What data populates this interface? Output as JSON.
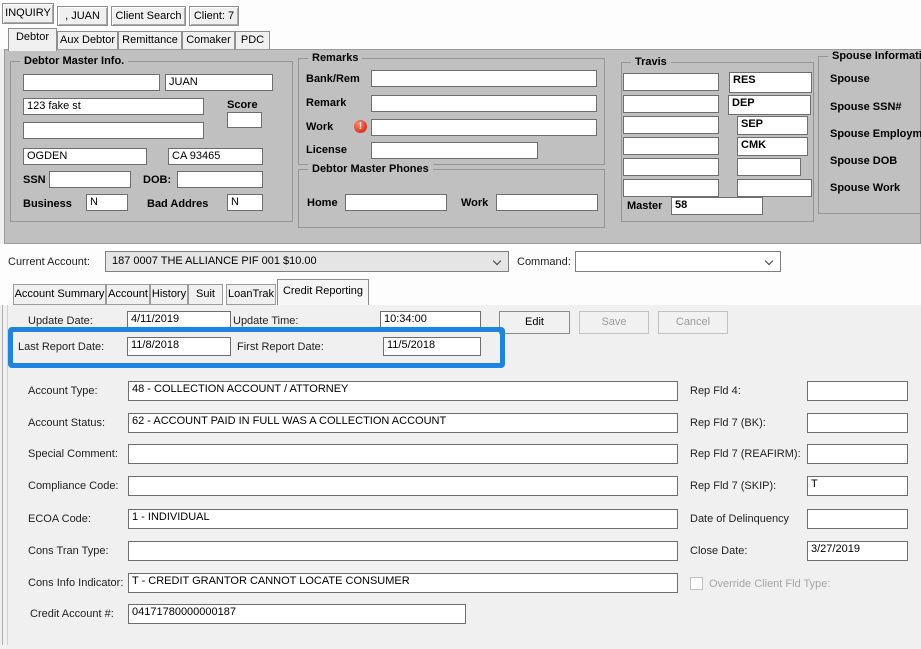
{
  "colors": {
    "highlight_blue": "#1e84e4",
    "alert_red": "#dd2c17",
    "panel_gray": "#c0c0c0"
  },
  "icons": {
    "work_alert": "!"
  },
  "top_buttons": {
    "inquiry": "INQUIRY",
    "debtor_name": ", JUAN",
    "client_search": "Client Search",
    "client": "Client: 7"
  },
  "debtor_tabs": [
    {
      "label": "Debtor"
    },
    {
      "label": "Aux Debtor"
    },
    {
      "label": "Remittance"
    },
    {
      "label": "Comaker"
    },
    {
      "label": "PDC"
    }
  ],
  "debtor_master": {
    "title": "Debtor Master Info.",
    "last_name": "",
    "first_name": "JUAN",
    "address1": "123 fake st",
    "address2": "",
    "score_label": "Score",
    "score": "",
    "city": "OGDEN",
    "state_zip": "CA 93465",
    "ssn_label": "SSN",
    "ssn": "",
    "dob_label": "DOB:",
    "dob": "",
    "business_label": "Business",
    "business": "N",
    "bad_address_label": "Bad Addres",
    "bad_address": "N"
  },
  "remarks": {
    "title": "Remarks",
    "bank_rem_label": "Bank/Rem",
    "bank_rem": "",
    "remark_label": "Remark",
    "remark": "",
    "work_label": "Work",
    "work": "",
    "license_label": "License",
    "license": ""
  },
  "phones": {
    "title": "Debtor Master Phones",
    "home_label": "Home",
    "home": "",
    "work_label": "Work",
    "work": ""
  },
  "travis": {
    "title": "Travis",
    "left_fields": [
      "",
      "",
      "",
      "",
      "",
      ""
    ],
    "right_fields": [
      "RES",
      "DEP",
      "SEP",
      "CMK",
      "",
      ""
    ],
    "master_label": "Master",
    "master_value": "58"
  },
  "spouse": {
    "title": "Spouse Information",
    "labels": [
      "Spouse",
      "Spouse SSN#",
      "Spouse Employment",
      "Spouse DOB",
      "Spouse Work"
    ]
  },
  "account_bar": {
    "current_account_label": "Current Account:",
    "current_account_value": "187 0007 THE ALLIANCE PIF 001 $10.00",
    "command_label": "Command:",
    "command_value": ""
  },
  "account_tabs": [
    {
      "label": "Account Summary"
    },
    {
      "label": "Account"
    },
    {
      "label": "History"
    },
    {
      "label": "Suit"
    },
    {
      "label": "LoanTrak"
    },
    {
      "label": "Credit Reporting"
    }
  ],
  "credit": {
    "update_date_label": "Update Date:",
    "update_date": "4/11/2019",
    "update_time_label": "Update Time:",
    "update_time": "10:34:00",
    "edit_button": "Edit",
    "save_button": "Save",
    "cancel_button": "Cancel",
    "last_report_label": "Last Report Date:",
    "last_report_date": "11/8/2018",
    "first_report_label": "First Report Date:",
    "first_report_date": "11/5/2018",
    "left_fields": [
      {
        "label": "Account Type:",
        "value": "48 - COLLECTION ACCOUNT / ATTORNEY"
      },
      {
        "label": "Account Status:",
        "value": "62 - ACCOUNT PAID IN FULL WAS A COLLECTION ACCOUNT"
      },
      {
        "label": "Special Comment:",
        "value": ""
      },
      {
        "label": "Compliance Code:",
        "value": ""
      },
      {
        "label": "ECOA Code:",
        "value": "1 - INDIVIDUAL"
      },
      {
        "label": "Cons Tran Type:",
        "value": ""
      },
      {
        "label": "Cons Info Indicator:",
        "value": "T - CREDIT GRANTOR CANNOT LOCATE CONSUMER"
      },
      {
        "label": "Credit Account #:",
        "value": "04171780000000187"
      }
    ],
    "right_fields": [
      {
        "label": "Rep Fld 4:",
        "value": ""
      },
      {
        "label": "Rep Fld 7 (BK):",
        "value": ""
      },
      {
        "label": "Rep Fld 7 (REAFIRM):",
        "value": ""
      },
      {
        "label": "Rep Fld 7 (SKIP):",
        "value": "T"
      },
      {
        "label": "Date of Delinquency",
        "value": ""
      },
      {
        "label": "Close Date:",
        "value": "3/27/2019"
      }
    ],
    "override_label": "Override Client Fld Type:"
  }
}
